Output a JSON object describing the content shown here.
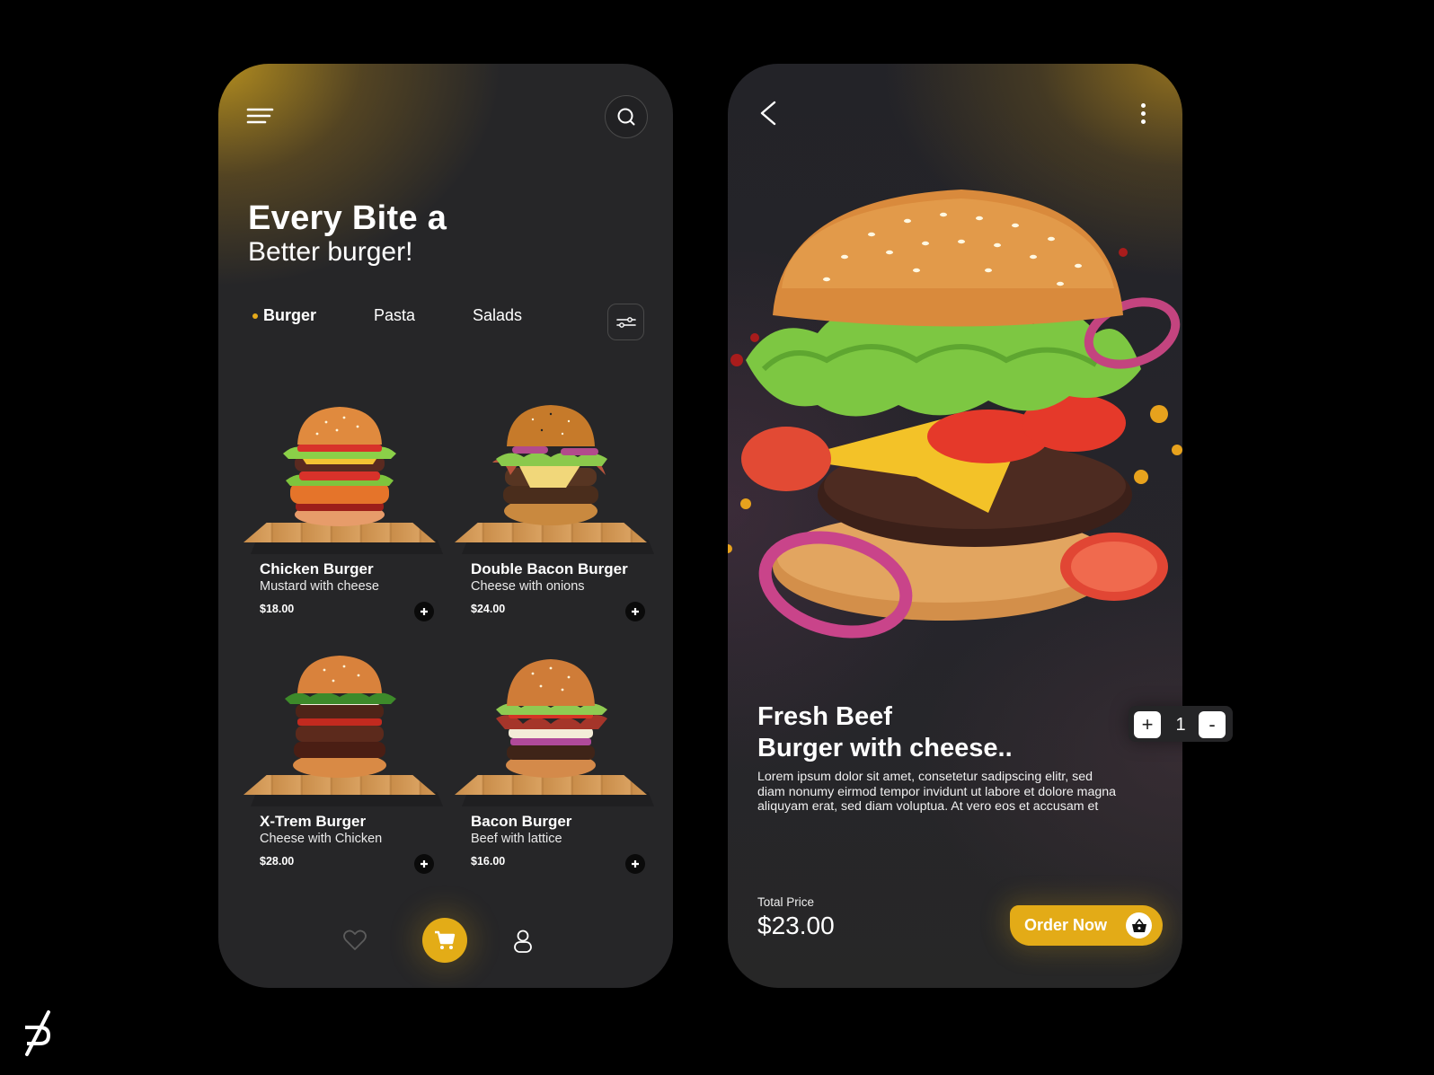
{
  "theme": {
    "accent": "#E3AB17",
    "background": "#000000",
    "card_bg": "#262628"
  },
  "menu_screen": {
    "icons": {
      "menu": "hamburger-menu-icon",
      "search": "search-icon",
      "filter": "sliders-icon"
    },
    "headline_bold": "Every Bite a",
    "headline_regular": "Better burger!",
    "categories": [
      {
        "label": "Burger",
        "active": true
      },
      {
        "label": "Pasta",
        "active": false
      },
      {
        "label": "Salads",
        "active": false
      }
    ],
    "products": [
      {
        "name": "Chicken Burger",
        "description": "Mustard with cheese",
        "price": "$18.00"
      },
      {
        "name": "Double Bacon Burger",
        "description": "Cheese with onions",
        "price": "$24.00"
      },
      {
        "name": "X-Trem Burger",
        "description": "Cheese with Chicken",
        "price": "$28.00"
      },
      {
        "name": "Bacon Burger",
        "description": "Beef with lattice",
        "price": "$16.00"
      }
    ],
    "bottom_nav": [
      {
        "icon": "heart-icon",
        "active": false
      },
      {
        "icon": "cart-icon",
        "active": true
      },
      {
        "icon": "user-icon",
        "active": false
      }
    ]
  },
  "detail_screen": {
    "icons": {
      "back": "chevron-left-icon",
      "more": "more-vertical-icon"
    },
    "title_line1": "Fresh Beef",
    "title_line2": "Burger with cheese..",
    "description": "Lorem ipsum dolor sit amet, consetetur sadipscing elitr, sed diam nonumy eirmod tempor invidunt ut labore et dolore magna aliquyam erat, sed diam voluptua. At vero eos et accusam et",
    "quantity": {
      "increment": "+",
      "value": "1",
      "decrement": "-"
    },
    "total_label": "Total Price",
    "total_value": "$23.00",
    "order_button": "Order Now"
  }
}
